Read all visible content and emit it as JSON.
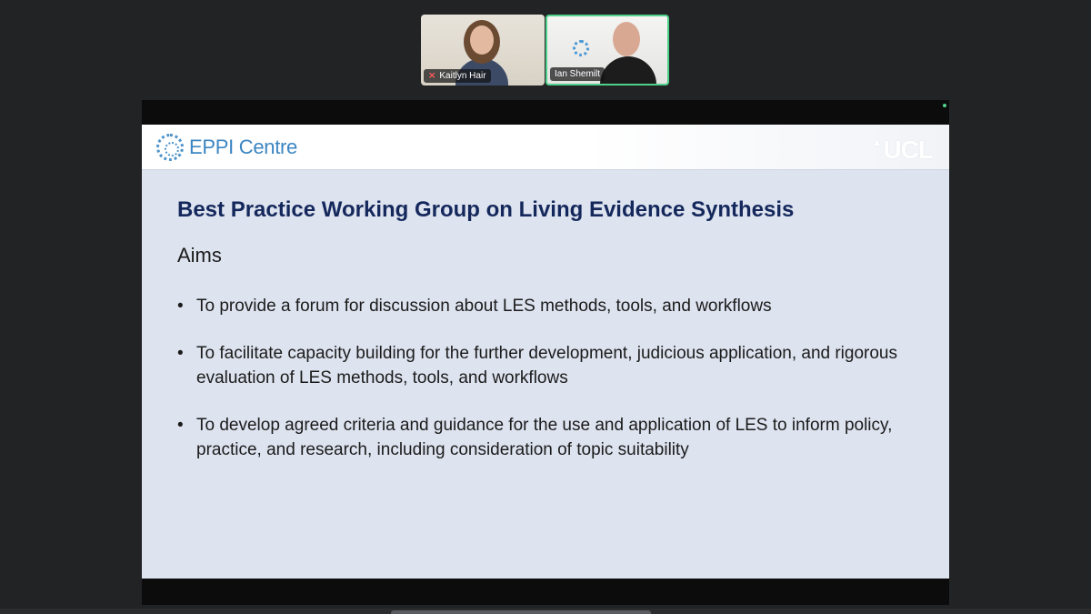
{
  "participants": [
    {
      "name": "Kaitlyn Hair",
      "muted": true
    },
    {
      "name": "Ian Shemilt",
      "muted": false,
      "active_speaker": true
    }
  ],
  "slide": {
    "header_logo": "EPPI Centre",
    "header_brand": "UCL",
    "title": "Best Practice Working Group on Living Evidence Synthesis",
    "subtitle": "Aims",
    "bullets": [
      "To provide a forum for discussion about LES methods, tools, and workflows",
      "To facilitate capacity building for the further development, judicious application, and rigorous evaluation of LES methods, tools, and workflows",
      "To develop agreed criteria and guidance for the use and application of LES to inform policy, practice, and research, including consideration of topic suitability"
    ]
  },
  "colors": {
    "active_speaker_border": "#4fd08a",
    "slide_title": "#14285c",
    "eppi_blue": "#3c86c2",
    "slide_background": "#dde3ef"
  },
  "icons": {
    "muted": "mic-off-icon",
    "logo": "eppi-centre-ring-icon"
  }
}
